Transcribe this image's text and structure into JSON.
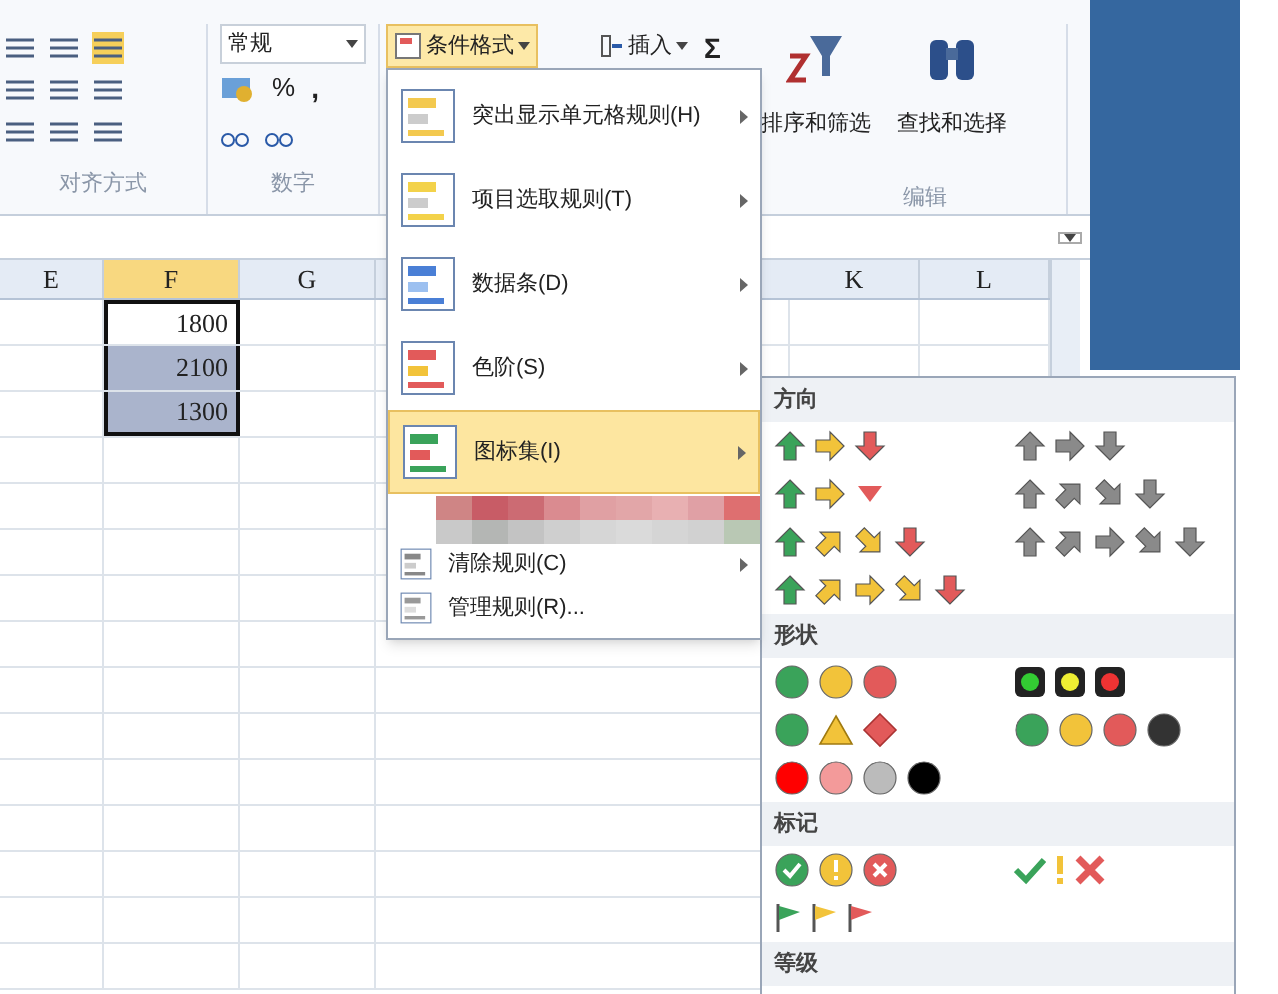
{
  "ribbon": {
    "alignment_group_label": "对齐方式",
    "number_format": "常规",
    "percent_symbol": "%",
    "comma_symbol": ",",
    "number_group_label": "数字",
    "conditional_format_button": "条件格式",
    "insert_button": "插入",
    "sum_symbol": "Σ",
    "sort_filter_button": "排序和筛选",
    "find_select_button": "查找和选择",
    "editing_group_label": "编辑"
  },
  "sheet": {
    "columns": [
      {
        "label": "E",
        "selected": false
      },
      {
        "label": "F",
        "selected": true
      },
      {
        "label": "G",
        "selected": false
      },
      {
        "label": "K",
        "selected": false
      },
      {
        "label": "L",
        "selected": false
      }
    ],
    "cells": [
      {
        "value": "1800",
        "selected": false
      },
      {
        "value": "2100",
        "selected": true
      },
      {
        "value": "1300",
        "selected": true
      }
    ]
  },
  "menu": {
    "items": [
      {
        "label": "突出显示单元格规则(H)",
        "kind": "large",
        "submenu": true,
        "selected": false
      },
      {
        "label": "项目选取规则(T)",
        "kind": "large",
        "submenu": true,
        "selected": false
      },
      {
        "label": "数据条(D)",
        "kind": "large",
        "submenu": true,
        "selected": false
      },
      {
        "label": "色阶(S)",
        "kind": "large",
        "submenu": true,
        "selected": false
      },
      {
        "label": "图标集(I)",
        "kind": "large",
        "submenu": true,
        "selected": true
      },
      {
        "label": "清除规则(C)",
        "kind": "small",
        "submenu": true,
        "selected": false
      },
      {
        "label": "管理规则(R)...",
        "kind": "small",
        "submenu": false,
        "selected": false
      }
    ]
  },
  "icon_sets_menu": {
    "sections": [
      {
        "title": "方向"
      },
      {
        "title": "形状"
      },
      {
        "title": "标记"
      },
      {
        "title": "等级"
      }
    ]
  }
}
